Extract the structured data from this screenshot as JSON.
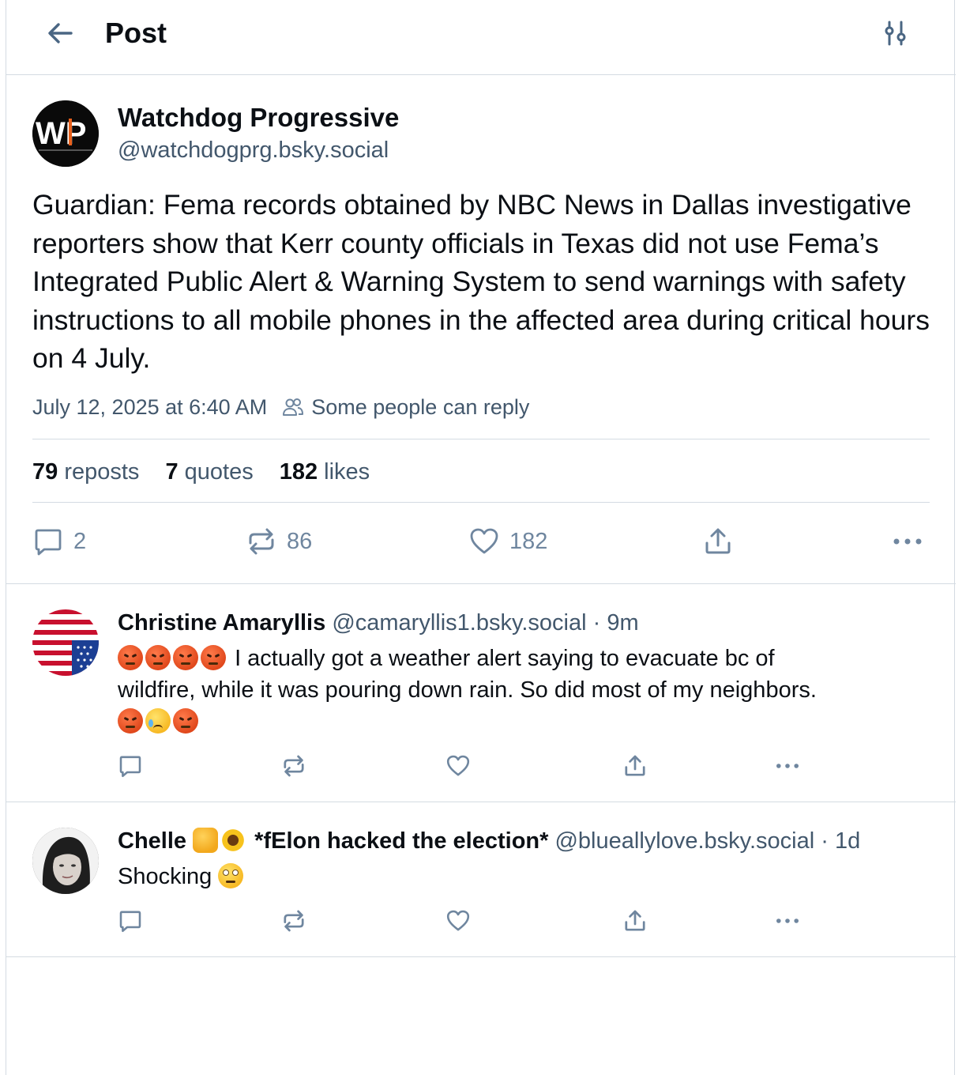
{
  "header": {
    "title": "Post"
  },
  "main_post": {
    "author_name": "Watchdog Progressive",
    "author_handle": "@watchdogprg.bsky.social",
    "avatar_text": "WP",
    "text": "Guardian: Fema records obtained by NBC News in Dallas investigative reporters show that Kerr county officials in Texas did not use Fema’s Integrated Public Alert & Warning System to send warnings with safety instructions to all mobile phones in the affected area during critical hours on 4 July.",
    "timestamp": "July 12, 2025 at 6:40 AM",
    "reply_setting": "Some people can reply",
    "stats": {
      "reposts_count": "79",
      "reposts_label": "reposts",
      "quotes_count": "7",
      "quotes_label": "quotes",
      "likes_count": "182",
      "likes_label": "likes"
    },
    "actions": {
      "reply_count": "2",
      "repost_count": "86",
      "like_count": "182"
    }
  },
  "replies": [
    {
      "author_name": "Christine Amaryllis",
      "author_handle": "@camaryllis1.bsky.social",
      "separator": "·",
      "age": "9m",
      "text_line1": "I actually got a weather alert saying to evacuate bc of",
      "text_line2": "wildfire, while it was pouring down rain. So did most of my neighbors."
    },
    {
      "author_name": "Chelle",
      "author_name_suffix": "*fElon hacked the election*",
      "author_handle": "@blueallylove.bsky.social",
      "separator": "·",
      "age": "1d",
      "text": "Shocking"
    }
  ],
  "colors": {
    "text": "#0b0f14",
    "muted": "#42576c",
    "icon": "#6f869f",
    "border": "#d4dbe2",
    "header_icon": "#4a6683"
  },
  "icons": [
    "back-arrow-icon",
    "sliders-icon",
    "people-icon",
    "reply-icon",
    "repost-icon",
    "heart-icon",
    "share-icon",
    "more-icon"
  ]
}
